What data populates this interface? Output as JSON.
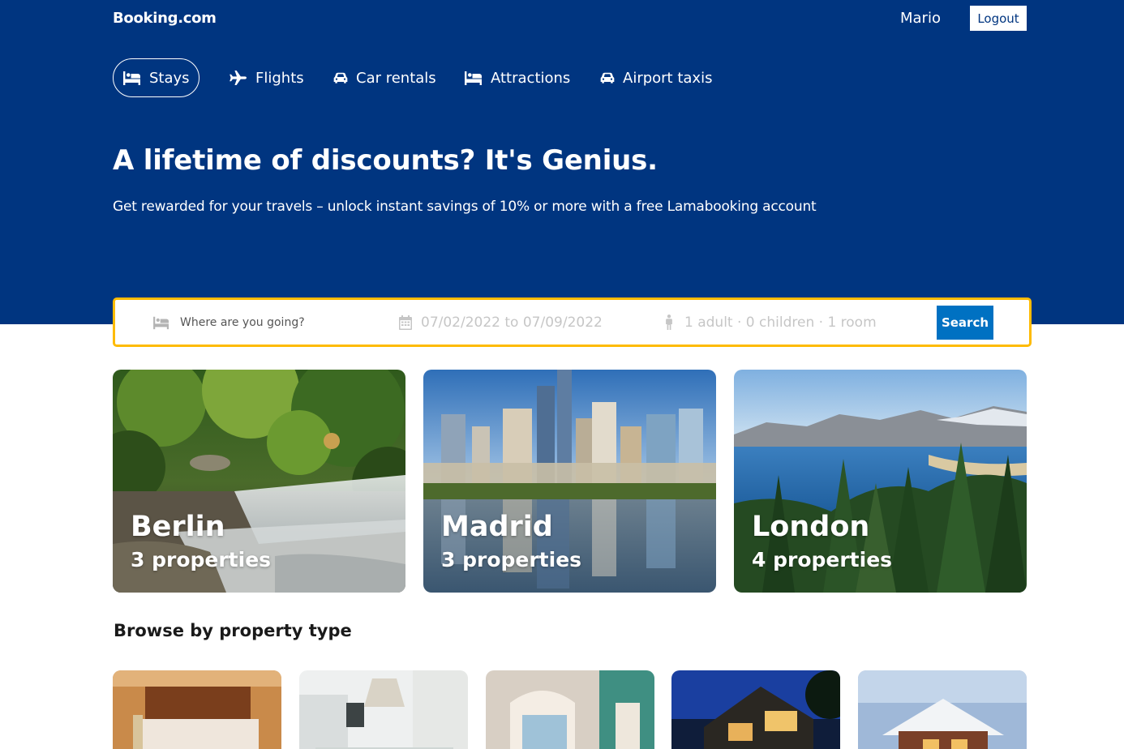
{
  "header": {
    "logo": "Booking.com",
    "user_name": "Mario",
    "logout_label": "Logout"
  },
  "nav": {
    "items": [
      {
        "label": "Stays",
        "icon": "bed-icon",
        "active": true
      },
      {
        "label": "Flights",
        "icon": "plane-icon",
        "active": false
      },
      {
        "label": "Car rentals",
        "icon": "car-icon",
        "active": false
      },
      {
        "label": "Attractions",
        "icon": "bed-icon",
        "active": false
      },
      {
        "label": "Airport taxis",
        "icon": "taxi-icon",
        "active": false
      }
    ]
  },
  "hero": {
    "title": "A lifetime of discounts? It's Genius.",
    "subtitle": "Get rewarded for your travels – unlock instant savings of 10% or more with a free Lamabooking account"
  },
  "search": {
    "destination_placeholder": "Where are you going?",
    "dates": "07/02/2022 to 07/09/2022",
    "guests": "1 adult · 0 children · 1 room",
    "button_label": "Search"
  },
  "featured": [
    {
      "city": "Berlin",
      "properties": "3 properties",
      "image": "waterfall-forest-photo"
    },
    {
      "city": "Madrid",
      "properties": "3 properties",
      "image": "city-skyline-lake-photo"
    },
    {
      "city": "London",
      "properties": "4 properties",
      "image": "lake-pine-forest-photo"
    }
  ],
  "property_types": {
    "title": "Browse by property type",
    "images": [
      "hotel-room-photo",
      "apartment-kitchen-photo",
      "resort-lounge-photo",
      "villa-night-photo",
      "cabin-snow-photo"
    ]
  },
  "colors": {
    "brand_blue": "#003580",
    "search_border": "#febb02",
    "button_blue": "#0071c2"
  }
}
